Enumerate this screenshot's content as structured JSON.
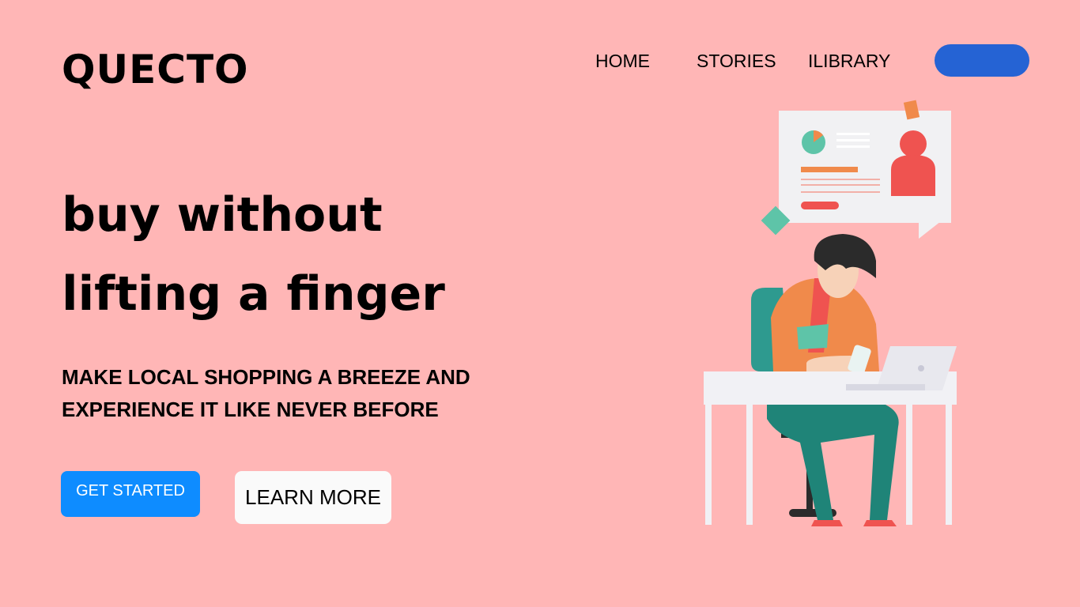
{
  "brand": {
    "logo": "QUECTO"
  },
  "nav": {
    "items": [
      {
        "label": "HOME"
      },
      {
        "label": "STORIES"
      },
      {
        "label": "ILIBRARY"
      }
    ],
    "cta_color": "#2563d4"
  },
  "hero": {
    "headline_line1": "buy without",
    "headline_line2": "lifting a finger",
    "subhead_line1": "MAKE LOCAL SHOPPING A BREEZE AND",
    "subhead_line2": "EXPERIENCE IT LIKE NEVER BEFORE",
    "primary_button": "GET STARTED",
    "secondary_button": "LEARN MORE"
  },
  "colors": {
    "background": "#ffb6b6",
    "primary_button": "#0e8cff",
    "secondary_button": "#fafafa"
  },
  "illustration": {
    "icon": "person-using-phone-at-desk-illustration"
  }
}
